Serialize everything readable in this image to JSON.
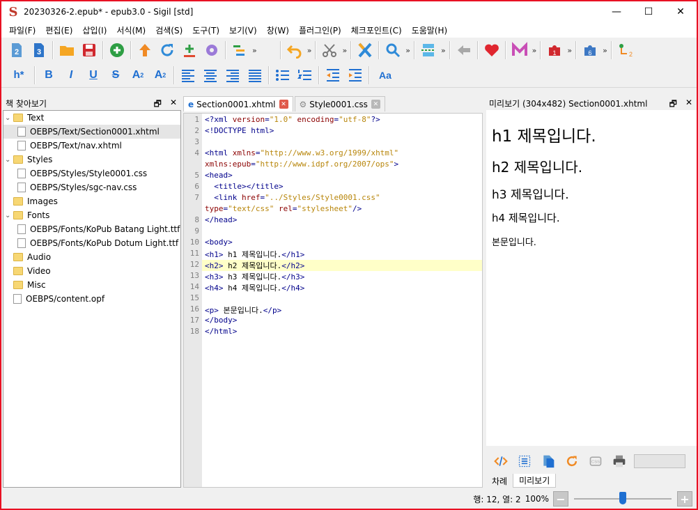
{
  "window": {
    "title": "20230326-2.epub* - epub3.0 - Sigil [std]",
    "logo_glyph": "S",
    "controls": [
      "—",
      "☐",
      "✕"
    ]
  },
  "menu": [
    "파일(F)",
    "편집(E)",
    "삽입(I)",
    "서식(M)",
    "검색(S)",
    "도구(T)",
    "보기(V)",
    "창(W)",
    "플러그인(P)",
    "체크포인트(C)",
    "도움말(H)"
  ],
  "toolbar2": {
    "heading": "h*",
    "bold": "B",
    "italic": "I",
    "underline": "U",
    "strike": "S",
    "subscript": "A",
    "superscript": "A",
    "case": "Aa"
  },
  "book_browser": {
    "title": "책 찾아보기",
    "tree": [
      {
        "label": "Text",
        "type": "folder",
        "level": 0,
        "caret": "⌄"
      },
      {
        "label": "OEBPS/Text/Section0001.xhtml",
        "type": "file",
        "level": 1,
        "selected": true
      },
      {
        "label": "OEBPS/Text/nav.xhtml",
        "type": "file",
        "level": 1
      },
      {
        "label": "Styles",
        "type": "folder",
        "level": 0,
        "caret": "⌄"
      },
      {
        "label": "OEBPS/Styles/Style0001.css",
        "type": "file",
        "level": 1
      },
      {
        "label": "OEBPS/Styles/sgc-nav.css",
        "type": "file",
        "level": 1
      },
      {
        "label": "Images",
        "type": "folder",
        "level": 0
      },
      {
        "label": "Fonts",
        "type": "folder",
        "level": 0,
        "caret": "⌄"
      },
      {
        "label": "OEBPS/Fonts/KoPub Batang Light.ttf",
        "type": "file",
        "level": 1
      },
      {
        "label": "OEBPS/Fonts/KoPub Dotum Light.ttf",
        "type": "file",
        "level": 1
      },
      {
        "label": "Audio",
        "type": "folder",
        "level": 0
      },
      {
        "label": "Video",
        "type": "folder",
        "level": 0
      },
      {
        "label": "Misc",
        "type": "folder",
        "level": 0
      },
      {
        "label": "OEBPS/content.opf",
        "type": "file",
        "level": 0
      }
    ]
  },
  "editor": {
    "tabs": [
      {
        "label": "Section0001.xhtml",
        "active": true,
        "close_color": "#e05a4b"
      },
      {
        "label": "Style0001.css",
        "active": false,
        "close_color": "#b8b8b8"
      }
    ],
    "lines": [
      {
        "n": "1",
        "parts": [
          [
            "tag",
            "<?xml "
          ],
          [
            "attr",
            "version"
          ],
          [
            "tag",
            "="
          ],
          [
            "val",
            "\"1.0\""
          ],
          [
            "tag",
            " "
          ],
          [
            "attr",
            "encoding"
          ],
          [
            "tag",
            "="
          ],
          [
            "val",
            "\"utf-8\""
          ],
          [
            "tag",
            "?>"
          ]
        ]
      },
      {
        "n": "2",
        "parts": [
          [
            "tag",
            "<!DOCTYPE html>"
          ]
        ]
      },
      {
        "n": "3",
        "parts": []
      },
      {
        "n": "4",
        "parts": [
          [
            "tag",
            "<html "
          ],
          [
            "attr",
            "xmlns"
          ],
          [
            "tag",
            "="
          ],
          [
            "val",
            "\"http://www.w3.org/1999/xhtml\""
          ]
        ]
      },
      {
        "n": "",
        "parts": [
          [
            "attr",
            "xmlns:epub"
          ],
          [
            "tag",
            "="
          ],
          [
            "val",
            "\"http://www.idpf.org/2007/ops\""
          ],
          [
            "tag",
            ">"
          ]
        ]
      },
      {
        "n": "5",
        "parts": [
          [
            "tag",
            "<head>"
          ]
        ]
      },
      {
        "n": "6",
        "parts": [
          [
            "tag",
            "  <title></title>"
          ]
        ]
      },
      {
        "n": "7",
        "parts": [
          [
            "tag",
            "  <link "
          ],
          [
            "attr",
            "href"
          ],
          [
            "tag",
            "="
          ],
          [
            "val",
            "\"../Styles/Style0001.css\""
          ]
        ]
      },
      {
        "n": "",
        "parts": [
          [
            "attr",
            "type"
          ],
          [
            "tag",
            "="
          ],
          [
            "val",
            "\"text/css\""
          ],
          [
            "tag",
            " "
          ],
          [
            "attr",
            "rel"
          ],
          [
            "tag",
            "="
          ],
          [
            "val",
            "\"stylesheet\""
          ],
          [
            "tag",
            "/>"
          ]
        ]
      },
      {
        "n": "8",
        "parts": [
          [
            "tag",
            "</head>"
          ]
        ]
      },
      {
        "n": "9",
        "parts": []
      },
      {
        "n": "10",
        "parts": [
          [
            "tag",
            "<body>"
          ]
        ]
      },
      {
        "n": "11",
        "parts": [
          [
            "tag",
            "<h1>"
          ],
          [
            "txt",
            " h1 제목입니다."
          ],
          [
            "tag",
            "</h1>"
          ]
        ]
      },
      {
        "n": "12",
        "hl": true,
        "parts": [
          [
            "tag",
            "<h2>"
          ],
          [
            "txt",
            " h2 제목입니다."
          ],
          [
            "tag",
            "</h2>"
          ]
        ]
      },
      {
        "n": "13",
        "parts": [
          [
            "tag",
            "<h3>"
          ],
          [
            "txt",
            " h3 제목입니다."
          ],
          [
            "tag",
            "</h3>"
          ]
        ]
      },
      {
        "n": "14",
        "parts": [
          [
            "tag",
            "<h4>"
          ],
          [
            "txt",
            " h4 제목입니다."
          ],
          [
            "tag",
            "</h4>"
          ]
        ]
      },
      {
        "n": "15",
        "parts": []
      },
      {
        "n": "16",
        "parts": [
          [
            "tag",
            "<p>"
          ],
          [
            "txt",
            " 본문입니다."
          ],
          [
            "tag",
            "</p>"
          ]
        ]
      },
      {
        "n": "17",
        "parts": [
          [
            "tag",
            "</body>"
          ]
        ]
      },
      {
        "n": "18",
        "parts": [
          [
            "tag",
            "</html>"
          ]
        ]
      }
    ]
  },
  "preview": {
    "title": "미리보기 (304x482) Section0001.xhtml",
    "h1": "h1 제목입니다.",
    "h2": "h2 제목입니다.",
    "h3": "h3 제목입니다.",
    "h4": "h4 제목입니다.",
    "p": "본문입니다.",
    "tabs": [
      "차례",
      "미리보기"
    ]
  },
  "status": {
    "position": "행: 12, 열: 2",
    "zoom": "100%",
    "zoom_fraction": 0.5
  },
  "colors": {
    "window_border": "#e81123",
    "tag": "#00008b",
    "attr": "#8b0000",
    "val": "#b8860b",
    "highlight": "#ffffc8",
    "accent": "#1f6fd1"
  }
}
